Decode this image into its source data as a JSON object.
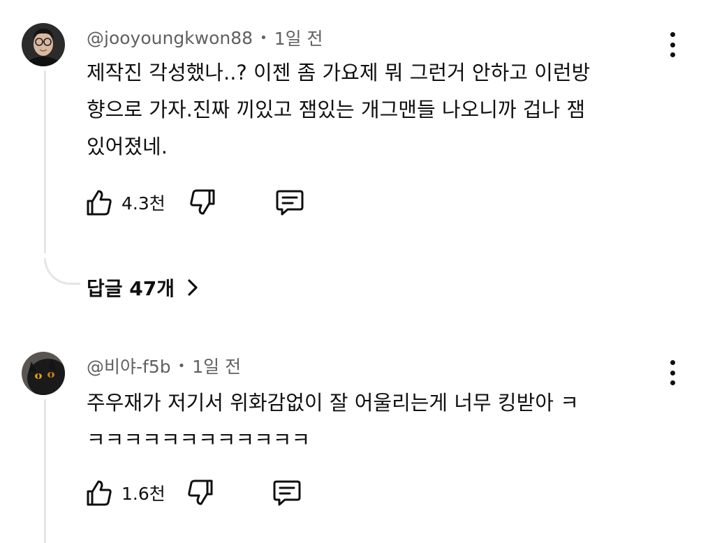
{
  "comments": [
    {
      "author": "@jooyoungkwon88",
      "time": "1일 전",
      "text_lines": [
        "제작진 각성했나..? 이젠 좀 가요제 뭐 그런거 안하고 이런방",
        "향으로 가자.진짜 끼있고 잼있는 개그맨들 나오니까 겁나 잼",
        "있어졌네."
      ],
      "likes": "4.3천",
      "replies_label": "답글 47개",
      "avatar_icon": "avatar-person-glasses"
    },
    {
      "author": "@비야-f5b",
      "time": "1일 전",
      "text_lines": [
        "주우재가 저기서 위화감없이 잘 어울리는게 너무 킹받아 ㅋ",
        "ㅋㅋㅋㅋㅋㅋㅋㅋㅋㅋㅋㅋ"
      ],
      "likes": "1.6천",
      "avatar_icon": "avatar-black-cat"
    }
  ],
  "icons": {
    "like": "thumbs-up-icon",
    "dislike": "thumbs-down-icon",
    "reply": "reply-comment-icon",
    "more": "more-vertical-icon",
    "chevron": "chevron-right-icon"
  },
  "colors": {
    "text": "#0f0f0f",
    "meta": "#606060",
    "thread_line": "#e5e5e5"
  }
}
